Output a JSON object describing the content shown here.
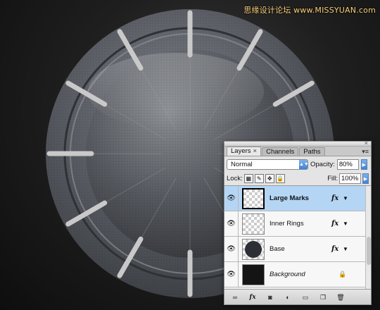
{
  "watermark": "思缘设计论坛 www.MISSYUAN.com",
  "panel": {
    "tabs": [
      {
        "label": "Layers",
        "close": "×"
      },
      {
        "label": "Channels"
      },
      {
        "label": "Paths"
      }
    ],
    "menu": "▾≡",
    "blend_mode": "Normal",
    "opacity_label": "Opacity:",
    "opacity_value": "80%",
    "lock_label": "Lock:",
    "fill_label": "Fill:",
    "fill_value": "100%",
    "layers": [
      {
        "name": "Large Marks",
        "fx": "fx",
        "selected": true,
        "thumb": "checker"
      },
      {
        "name": "Inner Rings",
        "fx": "fx",
        "selected": false,
        "thumb": "checker"
      },
      {
        "name": "Base",
        "fx": "fx",
        "selected": false,
        "thumb": "circle"
      },
      {
        "name": "Background",
        "fx": "",
        "selected": false,
        "thumb": "black",
        "italic": true,
        "locked": true
      }
    ],
    "bottom_icons": [
      "link-icon",
      "fx-icon",
      "mask-icon",
      "adjustment-icon",
      "folder-icon",
      "new-layer-icon",
      "trash-icon"
    ]
  },
  "canvas": {
    "dial_marks": 12,
    "colors": {
      "body": "#5a5d62",
      "rim": "#737780",
      "marks": "#c9c9c9"
    }
  }
}
